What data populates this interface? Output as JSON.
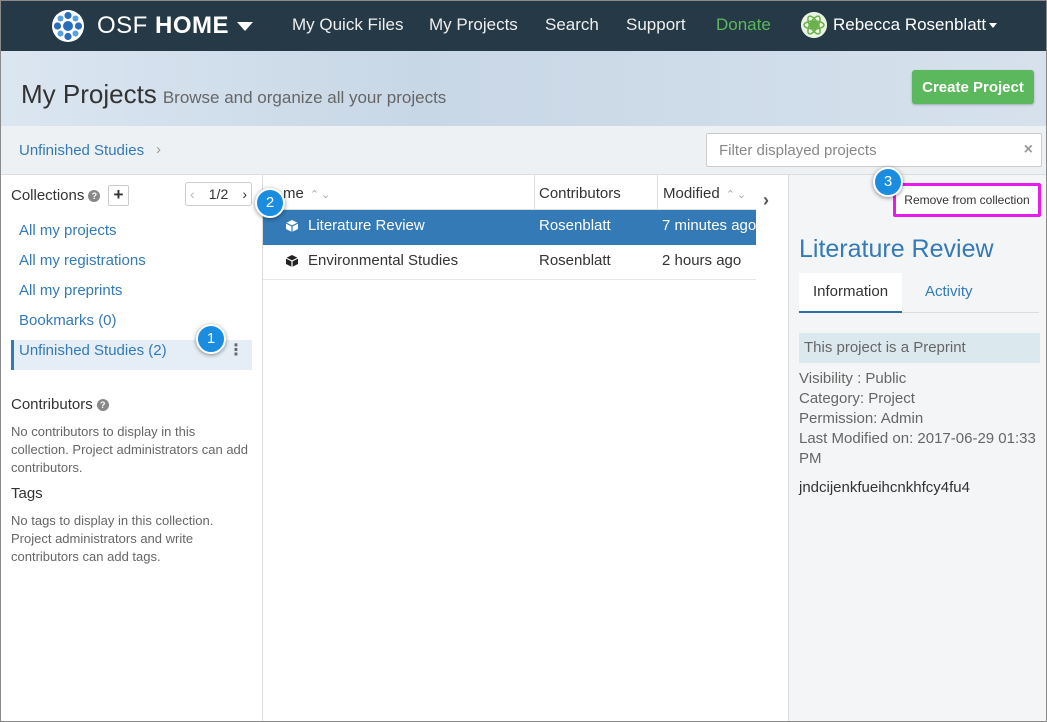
{
  "navbar": {
    "brand_light": "OSF ",
    "brand_bold": "HOME",
    "items": [
      {
        "label": "My Quick Files"
      },
      {
        "label": "My Projects"
      },
      {
        "label": "Search"
      },
      {
        "label": "Support"
      },
      {
        "label": "Donate"
      }
    ],
    "user_name": "Rebecca Rosenblatt"
  },
  "header": {
    "title": "My Projects",
    "subtitle": "Browse and organize all your projects",
    "create_button": "Create Project"
  },
  "breadcrumb": {
    "current": "Unfinished Studies",
    "separator": "›"
  },
  "filter": {
    "placeholder": "Filter displayed projects",
    "clear": "×"
  },
  "sidebar": {
    "collections_label": "Collections",
    "add_label": "+",
    "pager": {
      "prev": "‹",
      "text": "1/2",
      "next": "›"
    },
    "items": [
      {
        "label": "All my projects"
      },
      {
        "label": "All my registrations"
      },
      {
        "label": "All my preprints"
      },
      {
        "label": "Bookmarks (0)"
      },
      {
        "label": "Unfinished Studies (2)"
      }
    ],
    "menu_glyph": "⋮",
    "contributors_title": "Contributors",
    "contributors_text": "No contributors to display in this collection. Project administrators can add contributors.",
    "tags_title": "Tags",
    "tags_text": "No tags to display in this collection. Project administrators and write contributors can add tags."
  },
  "table": {
    "columns": {
      "name": "me",
      "contributors": "Contributors",
      "modified": "Modified"
    },
    "sort_glyph": "⌃⌄",
    "rows": [
      {
        "name": "Literature Review",
        "contributors": "Rosenblatt",
        "modified": "7 minutes ago"
      },
      {
        "name": "Environmental Studies",
        "contributors": "Rosenblatt",
        "modified": "2 hours ago"
      }
    ],
    "collapse_glyph": "›"
  },
  "panel": {
    "remove_button": "Remove from collection",
    "title": "Literature Review",
    "tabs": [
      {
        "label": "Information"
      },
      {
        "label": "Activity"
      }
    ],
    "preprint_note": "This project is a Preprint",
    "meta": [
      "Visibility : Public",
      "Category: Project",
      "Permission: Admin",
      "Last Modified on: 2017-06-29 01:33 PM"
    ],
    "guid": "jndcijenkfueihcnkhfcy4fu4"
  },
  "callouts": [
    "1",
    "2",
    "3"
  ],
  "colors": {
    "navbar": "#263947",
    "link": "#337ab7",
    "success": "#5cb85c",
    "selected_row": "#337ab7",
    "highlight_border": "#e81ce8",
    "callout": "#1a8de0"
  }
}
